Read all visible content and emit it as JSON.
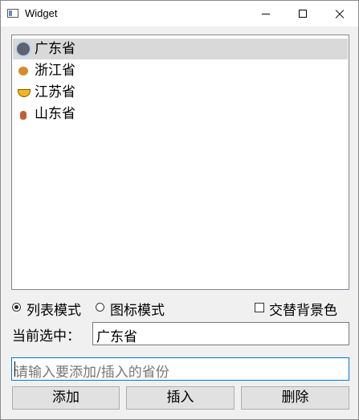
{
  "window": {
    "title": "Widget"
  },
  "list": {
    "items": [
      {
        "label": "广东省",
        "icon": "apple-icon",
        "selected": true
      },
      {
        "label": "浙江省",
        "icon": "orange-icon",
        "selected": false
      },
      {
        "label": "江苏省",
        "icon": "banana-icon",
        "selected": false
      },
      {
        "label": "山东省",
        "icon": "pot-icon",
        "selected": false
      }
    ]
  },
  "modes": {
    "list_mode": "列表模式",
    "icon_mode": "图标模式",
    "selected": "列表模式",
    "alternate_bg": "交替背景色",
    "alternate_bg_checked": false
  },
  "current": {
    "label": "当前选中：",
    "value": "广东省"
  },
  "input": {
    "placeholder": "请输入要添加/插入的省份",
    "value": ""
  },
  "buttons": {
    "add": "添加",
    "insert": "插入",
    "delete": "删除"
  },
  "colors": {
    "selected_row": "#d9d9d9",
    "focus_border": "#0078d7"
  }
}
